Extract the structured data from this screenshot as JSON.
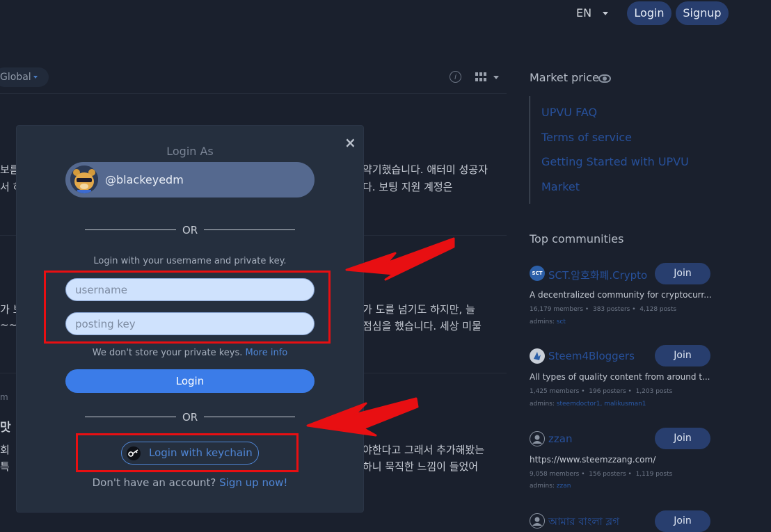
{
  "topbar": {
    "language": "EN",
    "login_label": "Login",
    "signup_label": "Signup"
  },
  "feed": {
    "filter_label": "Global",
    "info_icon": "info-icon",
    "layout_icon": "grid-icon",
    "posts": [
      {
        "left_fragment_1": "보름",
        "right_text_1": "약기했습니다. 애터미 성공자",
        "left_fragment_2": "서 하",
        "right_text_2": "다. 보팅 지원 계정은"
      },
      {
        "left_fragment_1": "가 보",
        "right_text_1": "가 도를 넘기도 하지만, 늘",
        "left_fragment_2": "~~",
        "right_text_2": "점심을 했습니다. 세상 미물"
      },
      {
        "meta_fragment": "m",
        "title_fragment": "맛",
        "left_fragment_1": "회",
        "right_text_1": "야한다고 그래서 추가해봤는",
        "left_fragment_2": "특",
        "right_text_2": "하니 묵직한 느낌이 들었어"
      }
    ]
  },
  "sidebar": {
    "market_title": "Market price",
    "market_icon": "eye-icon",
    "links": [
      "UPVU FAQ",
      "Terms of service",
      "Getting Started with UPVU",
      "Market"
    ],
    "communities_title": "Top communities",
    "communities": [
      {
        "name": "SCT.암호화폐.Crypto",
        "desc": "A decentralized community for cryptocurr...",
        "members": "16,179 members",
        "posters": "383 posters",
        "posts": "4,128 posts",
        "admins_label": "admins:",
        "admins": "sct",
        "join": "Join",
        "icon_text": "SCT"
      },
      {
        "name": "Steem4Bloggers",
        "desc": "All types of quality content from around t...",
        "members": "1,425 members",
        "posters": "196 posters",
        "posts": "1,203 posts",
        "admins_label": "admins:",
        "admins": "steemdoctor1, malikusman1",
        "join": "Join",
        "icon_text": ""
      },
      {
        "name": "zzan",
        "desc": "https://www.steemzzang.com/",
        "members": "9,058 members",
        "posters": "156 posters",
        "posts": "1,119 posts",
        "admins_label": "admins:",
        "admins": "zzan",
        "join": "Join",
        "icon_text": ""
      },
      {
        "name": "আমার বাংলা ব্লগ",
        "join": "Join",
        "icon_text": ""
      }
    ]
  },
  "modal": {
    "title": "Login As",
    "close": "×",
    "account": "@blackeyedm",
    "or_label": "OR",
    "instruction": "Login with your username and private key.",
    "username_placeholder": "username",
    "posting_placeholder": "posting key",
    "nostore_text": "We don't store your private keys.",
    "more_info": "More info",
    "login_label": "Login",
    "keychain_label": "Login with keychain",
    "noacct_text": "Don't have an account?",
    "signup_link": "Sign up now!"
  },
  "colors": {
    "background": "#1a202d",
    "modal": "#252f3e",
    "accent": "#3b7ce8",
    "annotation_red": "#e80f12"
  }
}
